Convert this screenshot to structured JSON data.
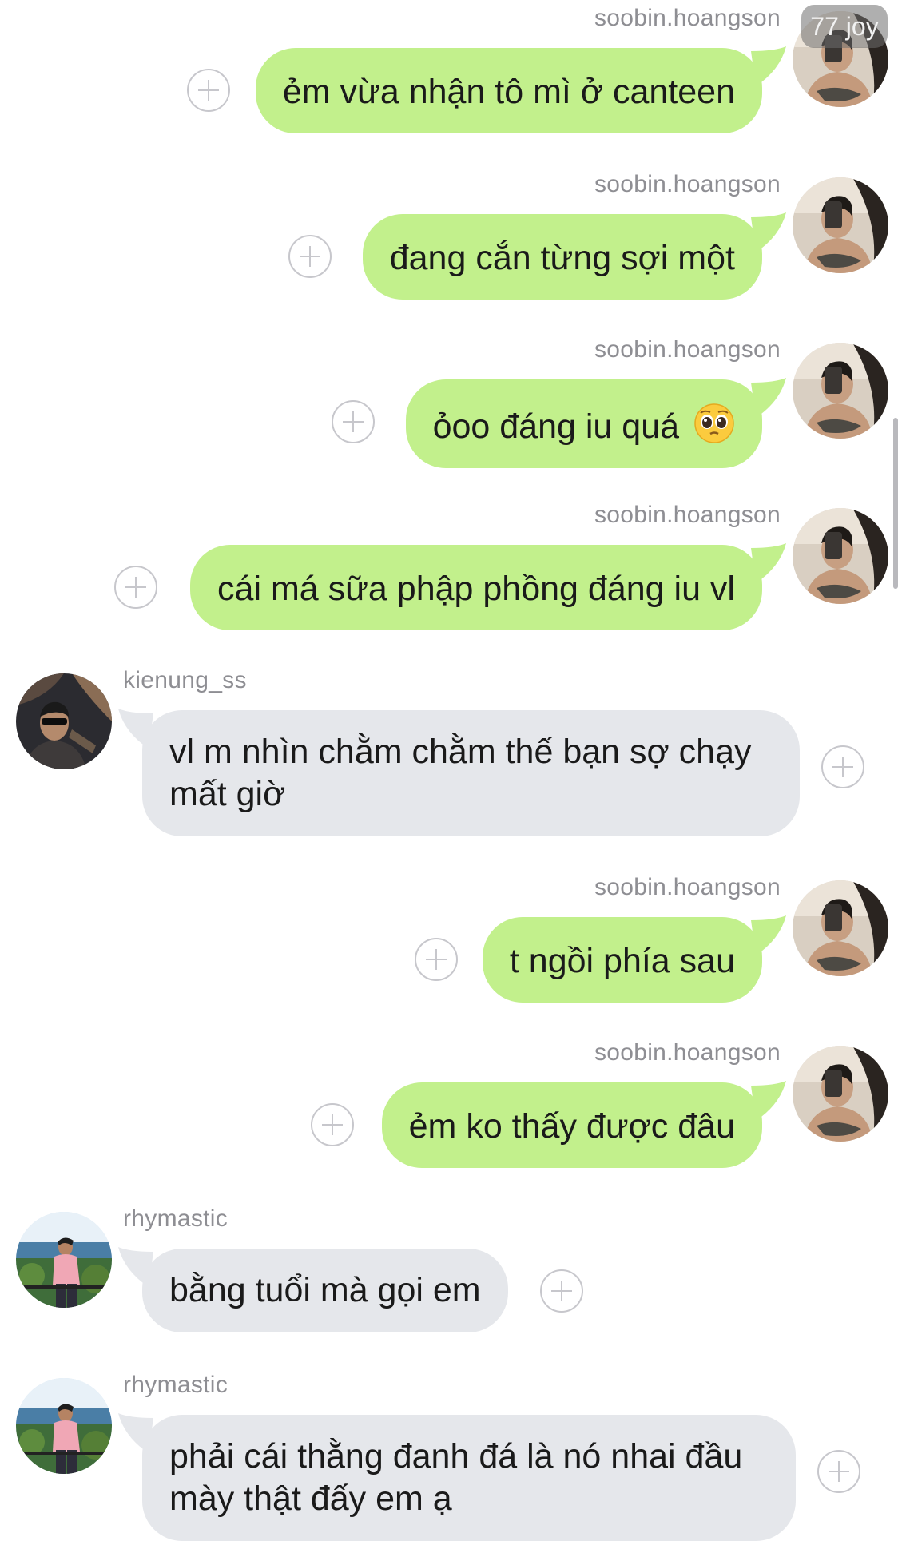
{
  "badge": "77 joy",
  "messages": [
    {
      "side": "out",
      "user": "soobin.hoangson",
      "text": "ẻm vừa nhận tô mì ở canteen"
    },
    {
      "side": "out",
      "user": "soobin.hoangson",
      "text": "đang cắn từng sợi một"
    },
    {
      "side": "out",
      "user": "soobin.hoangson",
      "text": "ỏoo đáng iu quá",
      "emoji": "pleading-face-emoji"
    },
    {
      "side": "out",
      "user": "soobin.hoangson",
      "text": "cái má sữa phập phồng đáng iu vl"
    },
    {
      "side": "in",
      "user": "kienung_ss",
      "text": "vl m nhìn chằm chằm thế bạn sợ chạy mất giờ"
    },
    {
      "side": "out",
      "user": "soobin.hoangson",
      "text": "t ngồi phía sau"
    },
    {
      "side": "out",
      "user": "soobin.hoangson",
      "text": "ẻm ko thấy được đâu"
    },
    {
      "side": "in",
      "user": "rhymastic",
      "text": "bằng tuổi mà gọi em"
    },
    {
      "side": "in",
      "user": "rhymastic",
      "text": "phải cái thằng đanh đá là nó nhai đầu mày thật đấy em ạ"
    }
  ],
  "colors": {
    "outgoing_bubble": "#c2f08c",
    "incoming_bubble": "#e5e7eb",
    "username": "#8e8e93",
    "plus_icon": "#c7c7cc"
  }
}
